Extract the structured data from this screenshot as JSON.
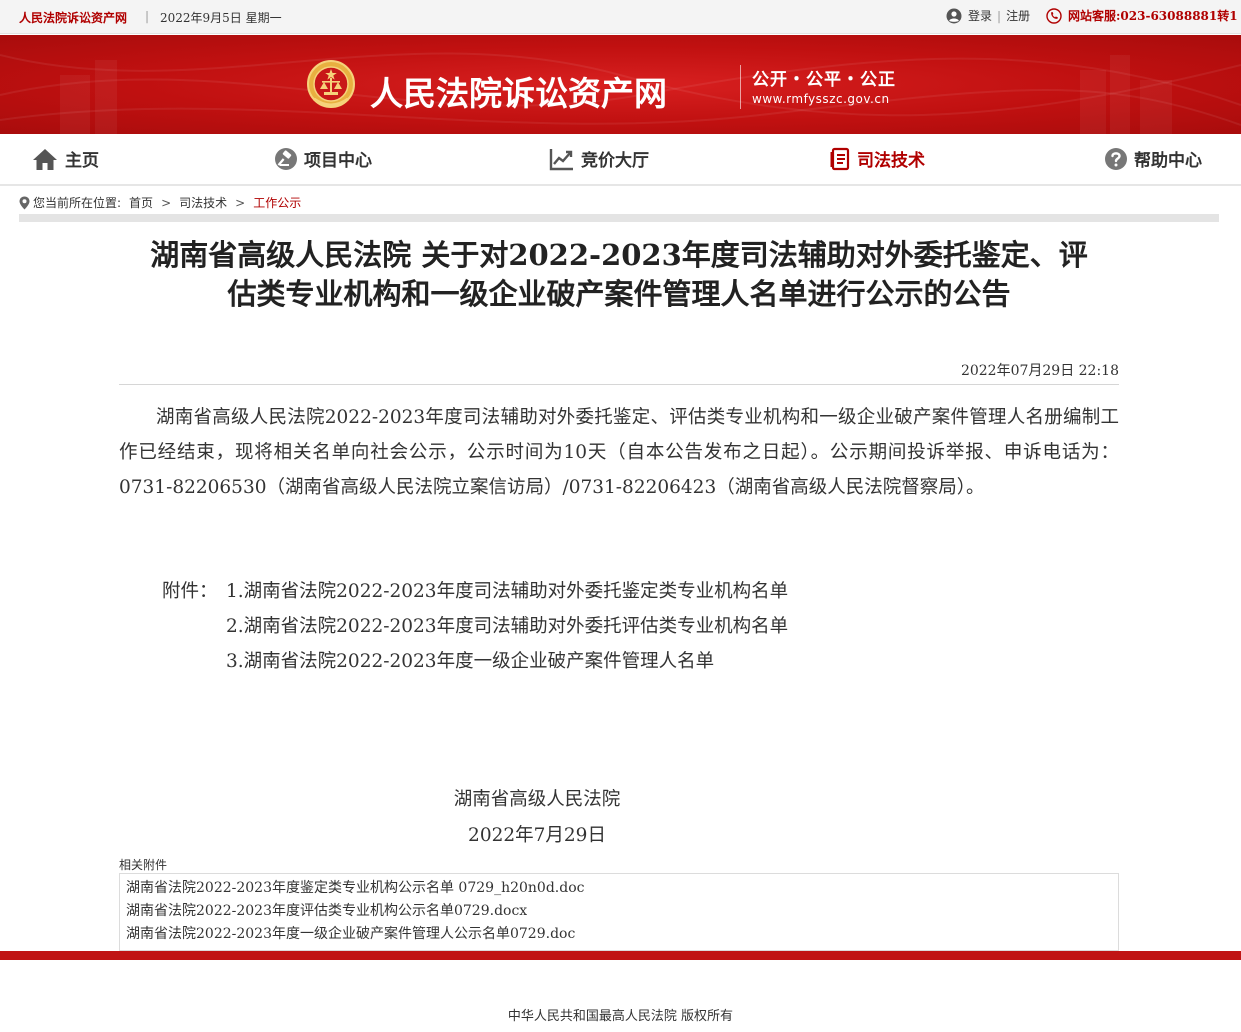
{
  "topbar": {
    "site_name": "人民法院诉讼资产网",
    "separator": "|",
    "date": "2022年9月5日 星期一",
    "login": "登录",
    "divider": "|",
    "register": "注册",
    "hotline": "网站客服:023-63088881转1"
  },
  "banner": {
    "title": "人民法院诉讼资产网",
    "motto": "公开・公平・公正",
    "domain": "www.rmfysszc.gov.cn"
  },
  "nav": {
    "items": [
      {
        "label": "主页",
        "icon": "home-icon"
      },
      {
        "label": "项目中心",
        "icon": "gavel-icon"
      },
      {
        "label": "竞价大厅",
        "icon": "trend-chart-icon"
      },
      {
        "label": "司法技术",
        "icon": "document-icon"
      },
      {
        "label": "帮助中心",
        "icon": "help-icon"
      }
    ],
    "active": "司法技术",
    "active_color": "#b00000"
  },
  "breadcrumb": {
    "location_label": "您当前所在位置:",
    "items": [
      "首页",
      "司法技术",
      "工作公示"
    ],
    "sep": ">"
  },
  "article": {
    "title_line1": "湖南省高级人民法院 关于对2022-2023年度司法辅助对外委托鉴定、评",
    "title_line2": "估类专业机构和一级企业破产案件管理人名单进行公示的公告",
    "time": "2022年07月29日 22:18",
    "paragraph": "湖南省高级人民法院2022-2023年度司法辅助对外委托鉴定、评估类专业机构和一级企业破产案件管理人名册编制工作已经结束，现将相关名单向社会公示，公示时间为10天（自本公告发布之日起）。公示期间投诉举报、申诉电话为：0731-82206530（湖南省高级人民法院立案信访局）/0731-82206423（湖南省高级人民法院督察局）。",
    "attachments_label": "附件：",
    "attachments": [
      "1.湖南省法院2022-2023年度司法辅助对外委托鉴定类专业机构名单",
      "2.湖南省法院2022-2023年度司法辅助对外委托评估类专业机构名单",
      "3.湖南省法院2022-2023年度一级企业破产案件管理人名单"
    ],
    "signer": "湖南省高级人民法院",
    "sign_date": "2022年7月29日"
  },
  "related": {
    "title": "相关附件",
    "files": [
      "湖南省法院2022-2023年度鉴定类专业机构公示名单 0729_h20n0d.doc",
      "湖南省法院2022-2023年度评估类专业机构公示名单0729.docx",
      "湖南省法院2022-2023年度一级企业破产案件管理人公示名单0729.doc"
    ]
  },
  "footer": {
    "copyright": "中华人民共和国最高人民法院 版权所有"
  },
  "colors": {
    "brand_red": "#c31414",
    "accent_red": "#b00000"
  }
}
